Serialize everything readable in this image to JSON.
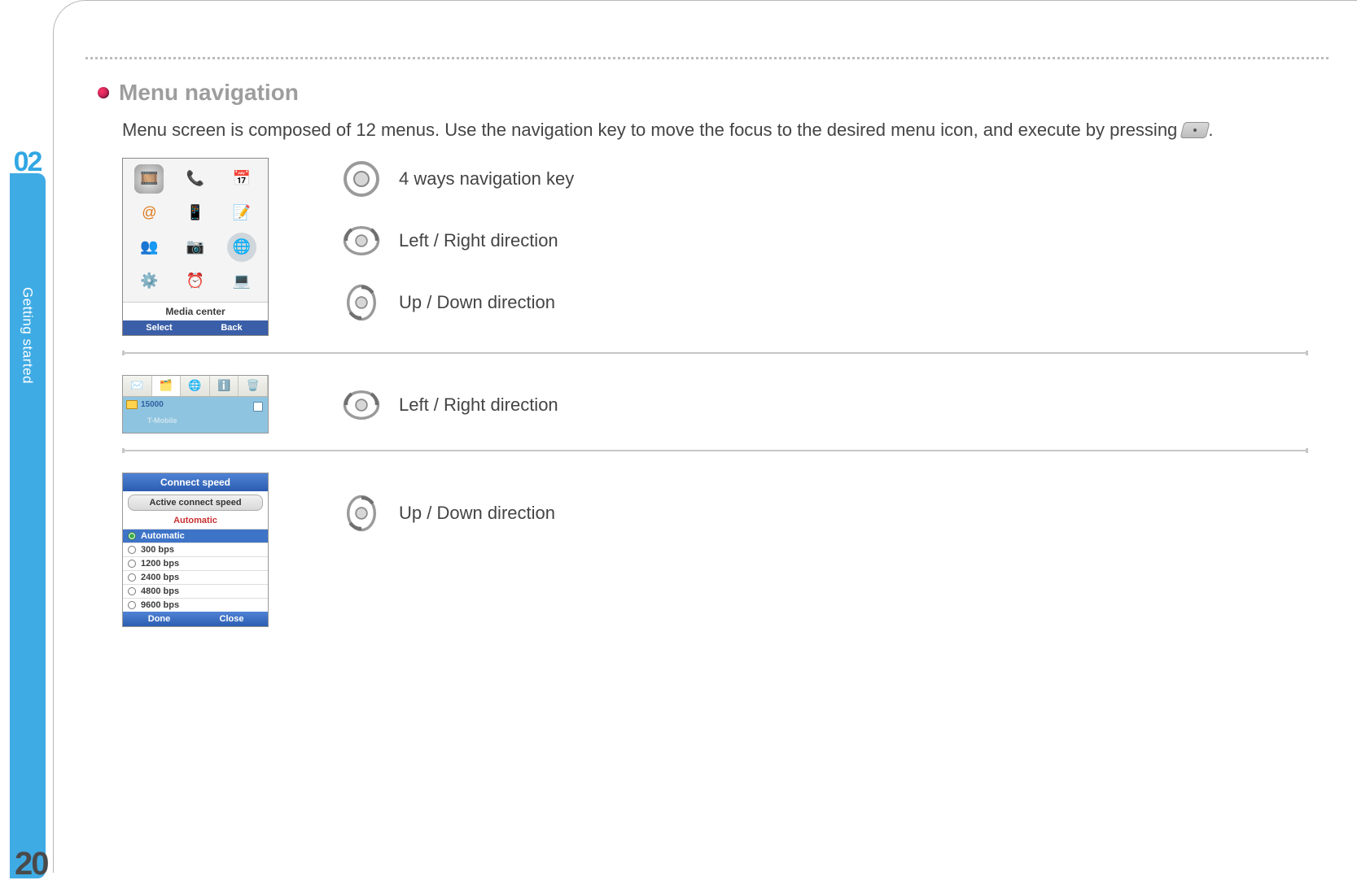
{
  "chapter_number": "02",
  "side_label": "Getting started",
  "page_number": "20",
  "section": {
    "title": "Menu navigation",
    "intro_pre": "Menu screen is composed of 12 menus. Use the navigation key to move the focus to the desired menu icon, and execute by pressing ",
    "intro_post": "."
  },
  "keys": {
    "four_way": "4 ways navigation key",
    "left_right": "Left / Right direction",
    "up_down": "Up / Down direction"
  },
  "phone1": {
    "selected_label": "Media center",
    "softkeys": {
      "left": "Select",
      "right": "Back"
    }
  },
  "phone2": {
    "count": "15000",
    "carrier": "T-Mobile"
  },
  "phone3": {
    "title": "Connect  speed",
    "button": "Active connect speed",
    "current": "Automatic",
    "options": [
      "Automatic",
      "300 bps",
      "1200 bps",
      "2400 bps",
      "4800 bps",
      "9600 bps"
    ],
    "softkeys": {
      "left": "Done",
      "right": "Close"
    }
  }
}
